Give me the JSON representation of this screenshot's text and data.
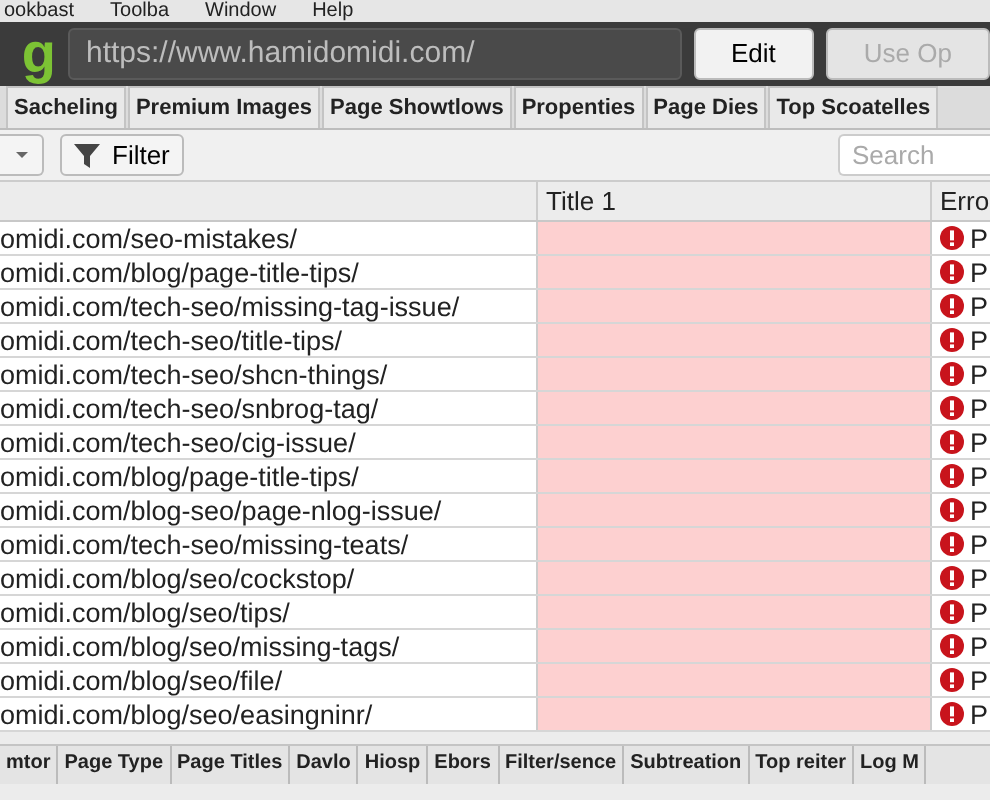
{
  "menu_bar": [
    "ookbast",
    "Toolba",
    "Window",
    "Help"
  ],
  "toolbar": {
    "logo": "g",
    "url": "https://www.hamidomidi.com/",
    "buttons": [
      {
        "label": "Edit",
        "disabled": false
      },
      {
        "label": "Use Op",
        "disabled": true
      }
    ]
  },
  "tabs": [
    {
      "label": "Sacheling",
      "selected": false
    },
    {
      "label": "Premium Images",
      "selected": false
    },
    {
      "label": "Page Showtlows",
      "selected": false
    },
    {
      "label": "Propenties",
      "selected": false
    },
    {
      "label": "Page Dies",
      "selected": false
    },
    {
      "label": "Top Scoatelles",
      "selected": false
    }
  ],
  "filter_bar": {
    "filter_button": "Filter",
    "search": {
      "placeholder": "Search"
    }
  },
  "table": {
    "columns": [
      "Title 1",
      "Erro"
    ],
    "rows": [
      {
        "url": "omidi.com/seo-mistakes/",
        "title_missing": true,
        "error": "P"
      },
      {
        "url": "omidi.com/blog/page-title-tips/",
        "title_missing": true,
        "error": "P"
      },
      {
        "url": "omidi.com/tech-seo/missing-tag-issue/",
        "title_missing": true,
        "error": "P"
      },
      {
        "url": "omidi.com/tech-seo/title-tips/",
        "title_missing": true,
        "error": "P"
      },
      {
        "url": "omidi.com/tech-seo/shcn-things/",
        "title_missing": true,
        "error": "P"
      },
      {
        "url": "omidi.com/tech-seo/snbrog-tag/",
        "title_missing": true,
        "error": "P"
      },
      {
        "url": "omidi.com/tech-seo/cig-issue/",
        "title_missing": true,
        "error": "P"
      },
      {
        "url": "omidi.com/blog/page-title-tips/",
        "title_missing": true,
        "error": "P"
      },
      {
        "url": "omidi.com/blog-seo/page-nlog-issue/",
        "title_missing": true,
        "error": "P"
      },
      {
        "url": "omidi.com/tech-seo/missing-teats/",
        "title_missing": true,
        "error": "P"
      },
      {
        "url": "omidi.com/blog/seo/cockstop/",
        "title_missing": true,
        "error": "P"
      },
      {
        "url": "omidi.com/blog/seo/tips/",
        "title_missing": true,
        "error": "P"
      },
      {
        "url": "omidi.com/blog/seo/missing-tags/",
        "title_missing": true,
        "error": "P"
      },
      {
        "url": "omidi.com/blog/seo/file/",
        "title_missing": true,
        "error": "P"
      },
      {
        "url": "omidi.com/blog/seo/easingninr/",
        "title_missing": true,
        "error": "P"
      }
    ]
  },
  "bottom_tabs": [
    {
      "label": "mtor",
      "selected": false
    },
    {
      "label": "Page Type",
      "selected": false
    },
    {
      "label": "Page Titles",
      "selected": false
    },
    {
      "label": "Davlo",
      "selected": false
    },
    {
      "label": "Hiosp",
      "selected": false
    },
    {
      "label": "Ebors",
      "selected": false
    },
    {
      "label": "Filter/sence",
      "selected": false
    },
    {
      "label": "Subtreation",
      "selected": false
    },
    {
      "label": "Top reiter",
      "selected": false
    },
    {
      "label": "Log M",
      "selected": false
    }
  ]
}
